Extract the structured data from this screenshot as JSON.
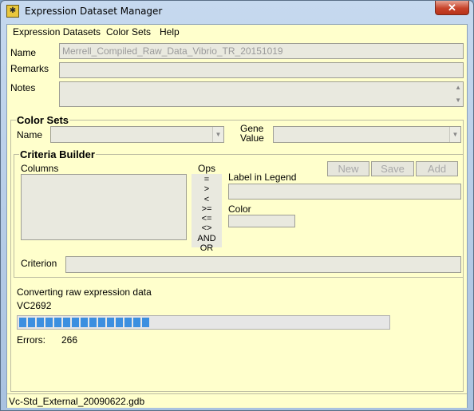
{
  "window": {
    "title": "Expression Dataset Manager",
    "close_glyph": "✕",
    "app_icon_glyph": "✱"
  },
  "menu": [
    "Expression Datasets",
    "Color Sets",
    "Help"
  ],
  "dataset": {
    "name_label": "Name",
    "name_value": "Merrell_Compiled_Raw_Data_Vibrio_TR_20151019",
    "remarks_label": "Remarks",
    "notes_label": "Notes"
  },
  "color_sets": {
    "title": "Color Sets",
    "name_label": "Name",
    "gene_value_label_line1": "Gene",
    "gene_value_label_line2": "Value"
  },
  "criteria_builder": {
    "title": "Criteria Builder",
    "columns_label": "Columns",
    "ops_label": "Ops",
    "ops": [
      "=",
      ">",
      "<",
      ">=",
      "<=",
      "<>",
      "AND",
      "OR"
    ],
    "label_in_legend": "Label in Legend",
    "color_label": "Color",
    "criterion_label": "Criterion",
    "buttons": {
      "new": "New",
      "save": "Save",
      "add": "Add"
    }
  },
  "progress": {
    "status": "Converting raw expression data",
    "item": "VC2692",
    "fraction": 0.36,
    "filled_segments": 15,
    "errors_label": "Errors:",
    "errors_value": "266"
  },
  "status_bar": "Vc-Std_External_20090622.gdb"
}
